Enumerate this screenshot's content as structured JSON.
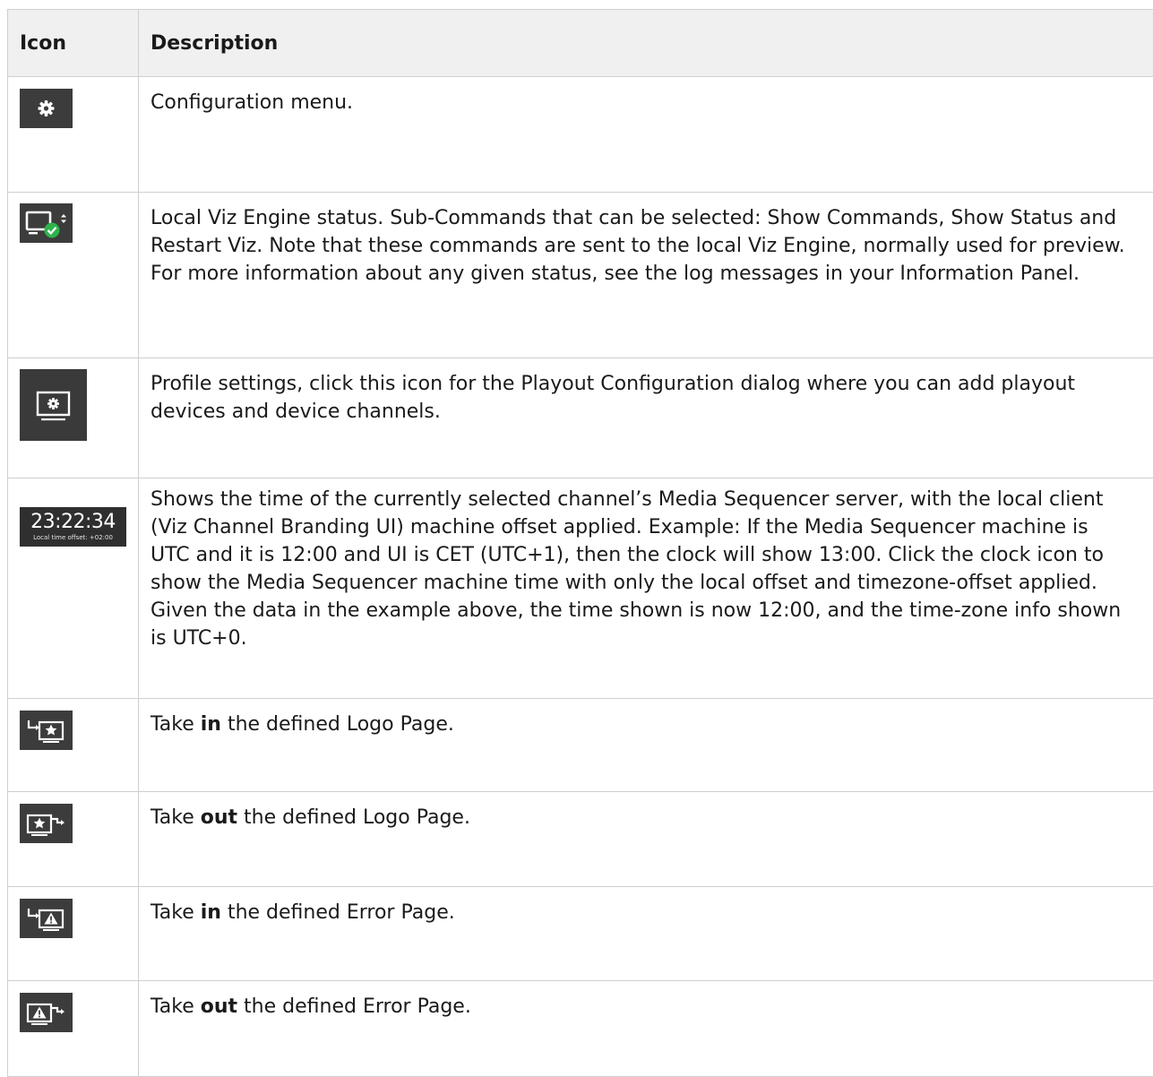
{
  "table": {
    "headers": {
      "icon": "Icon",
      "description": "Description"
    },
    "rows": [
      {
        "icon": "gear-icon",
        "description": "Configuration menu."
      },
      {
        "icon": "monitor-status-check-icon",
        "description": "Local Viz Engine status. Sub-Commands that can be selected: Show Commands, Show Status and Restart Viz. Note that these commands are sent to the local Viz Engine, normally used for preview. For more information about any given status, see the log messages in your Information Panel."
      },
      {
        "icon": "monitor-gear-icon",
        "description": "Profile settings, click this icon for the Playout Configuration dialog where you can add playout devices and device channels."
      },
      {
        "icon": "clock-icon",
        "clock_time": "23:22:34",
        "clock_offset": "Local time offset: +02:00",
        "description": "Shows the time of the currently selected channel’s Media Sequencer server, with the local client (Viz Channel Branding UI) machine offset applied. Example: If the Media Sequencer machine is UTC and it is 12:00 and UI is CET (UTC+1), then the clock will show 13:00. Click the clock icon to show the Media Sequencer machine time with only the local offset and timezone-offset applied. Given the data in the example above, the time shown is now 12:00, and the time-zone info shown is UTC+0."
      },
      {
        "icon": "take-in-logo-icon",
        "desc_pre": "Take ",
        "desc_bold": "in",
        "desc_post": " the defined Logo Page."
      },
      {
        "icon": "take-out-logo-icon",
        "desc_pre": "Take ",
        "desc_bold": "out",
        "desc_post": " the defined Logo Page."
      },
      {
        "icon": "take-in-error-icon",
        "desc_pre": "Take ",
        "desc_bold": "in",
        "desc_post": " the defined Error Page."
      },
      {
        "icon": "take-out-error-icon",
        "desc_pre": "Take ",
        "desc_bold": "out",
        "desc_post": " the defined Error Page."
      }
    ]
  },
  "colors": {
    "icon_bg": "#3c3c3c",
    "icon_fg": "#ffffff",
    "status_ok": "#2db34a",
    "border": "#cfcfcf",
    "header_bg": "#f0f0f0"
  }
}
